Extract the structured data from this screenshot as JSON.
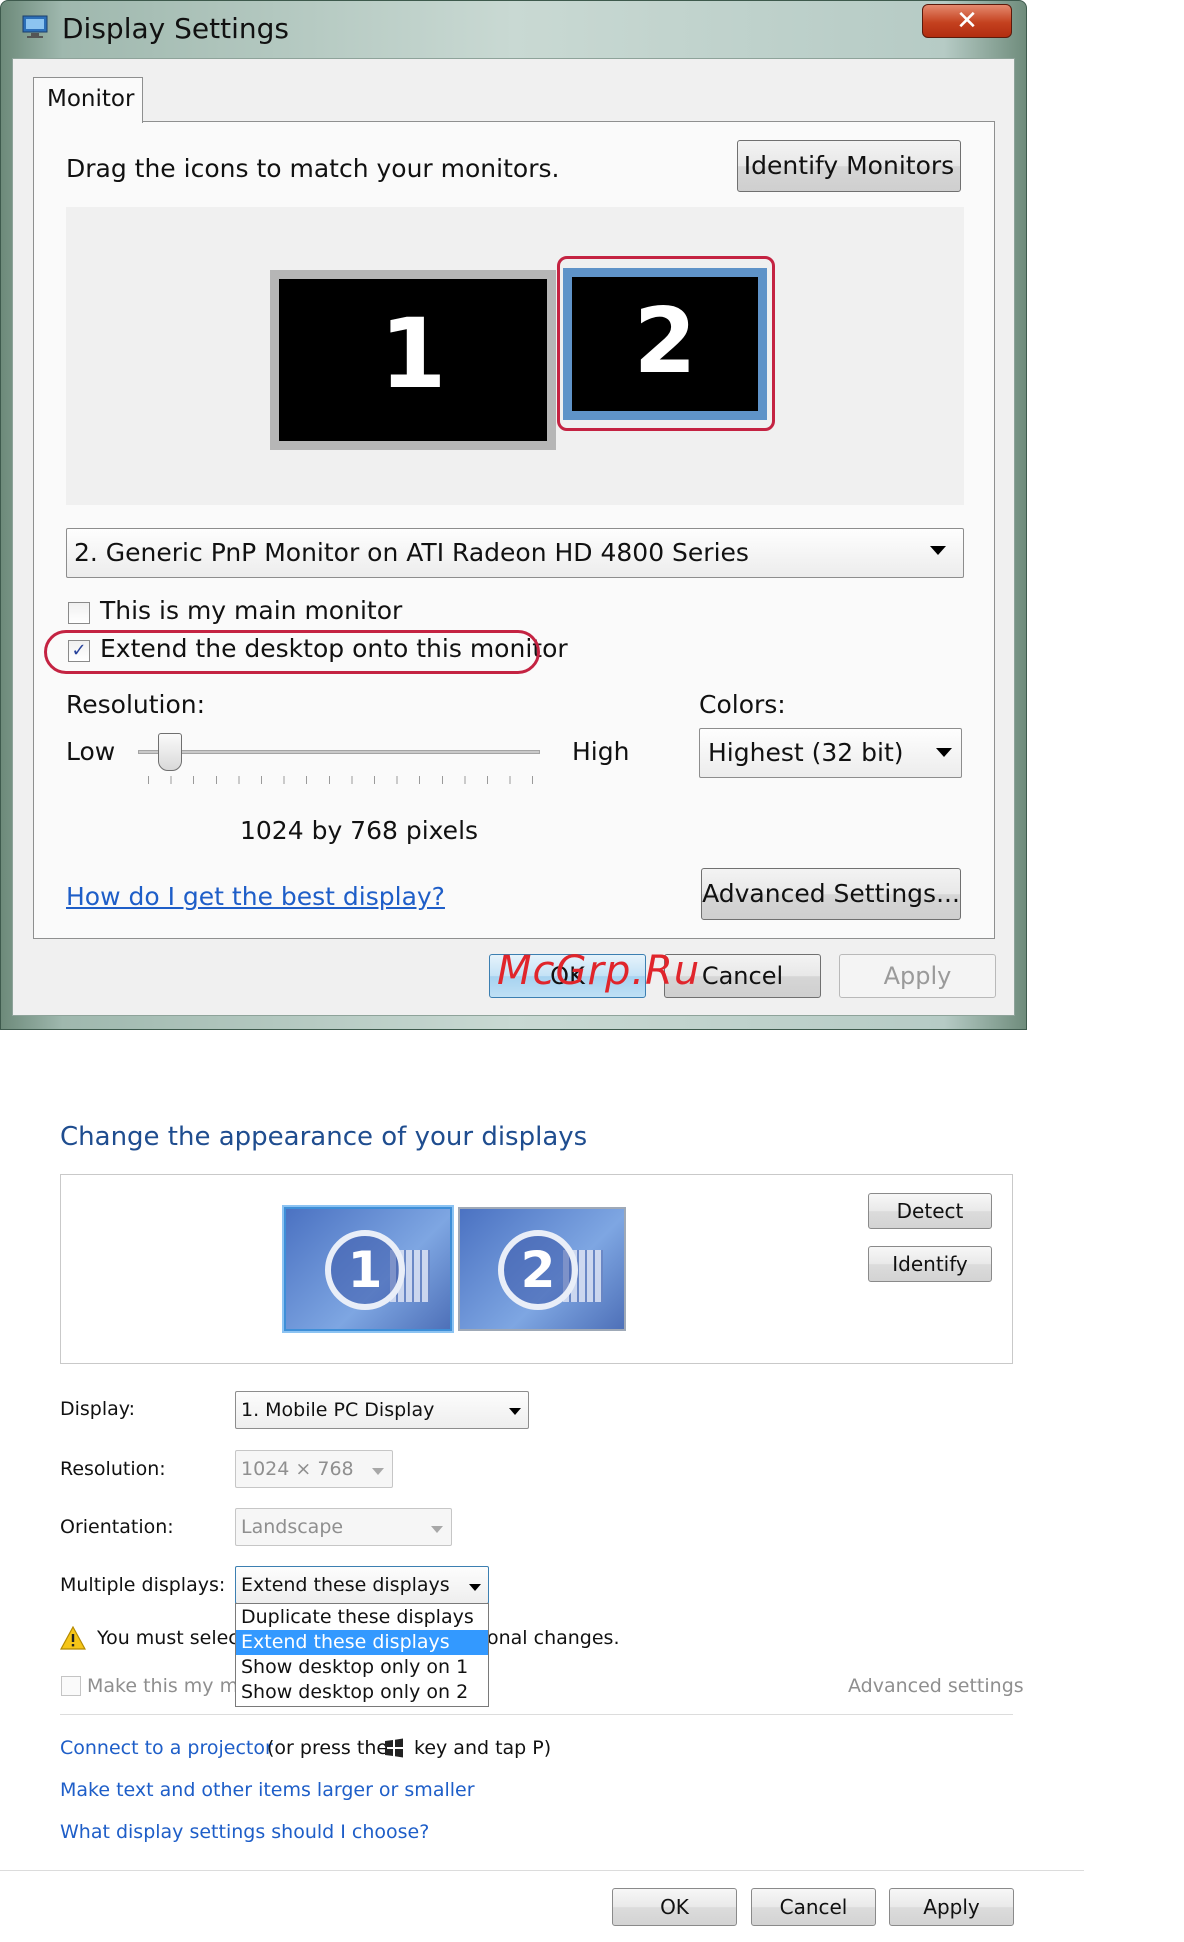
{
  "vista": {
    "title": "Display Settings",
    "close_label": "✕",
    "tab": "Monitor",
    "drag_text": "Drag the icons to match your monitors.",
    "identify_monitors": "Identify Monitors",
    "monitor1": "1",
    "monitor2": "2",
    "monitor_select": "2. Generic PnP Monitor on ATI Radeon HD 4800 Series",
    "main_monitor_label": "This is my main monitor",
    "main_monitor_checked": false,
    "extend_label": "Extend the desktop onto this monitor",
    "extend_checked": true,
    "extend_check_glyph": "✓",
    "resolution_label": "Resolution:",
    "low": "Low",
    "high": "High",
    "resolution_slider_position": 0.08,
    "resolution_value": "1024 by 768 pixels",
    "colors_label": "Colors:",
    "colors_value": "Highest (32 bit)",
    "help_link": "How do I get the best display?",
    "advanced_settings": "Advanced Settings...",
    "ok": "OK",
    "cancel": "Cancel",
    "apply": "Apply",
    "highlight_color": "#c42342",
    "watermark": "McGrp.Ru"
  },
  "win7": {
    "title": "Change the appearance of your displays",
    "monitor1": "1",
    "monitor2": "2",
    "detect": "Detect",
    "identify": "Identify",
    "display_label": "Display:",
    "display_value": "1. Mobile PC Display",
    "resolution_label": "Resolution:",
    "resolution_value": "1024 × 768",
    "orientation_label": "Orientation:",
    "orientation_value": "Landscape",
    "multiple_label": "Multiple displays:",
    "multiple_value": "Extend these displays",
    "multiple_options": [
      "Duplicate these displays",
      "Extend these displays",
      "Show desktop only on 1",
      "Show desktop only on 2"
    ],
    "warning_text_start": "You must select",
    "warning_text_end": "onal changes.",
    "make_main_label": "Make this my ma",
    "advanced_settings": "Advanced settings",
    "projector_link": "Connect to a projector",
    "projector_rest1": "(or press the",
    "projector_rest2": "key and tap P)",
    "text_link": "Make text and other items larger or smaller",
    "choose_link": "What display settings should I choose?",
    "ok": "OK",
    "cancel": "Cancel",
    "apply": "Apply",
    "link_color": "#1e5ec8",
    "selected_option_color": "#3399ff",
    "icons": [
      "warning-icon",
      "windows-key-icon"
    ]
  }
}
